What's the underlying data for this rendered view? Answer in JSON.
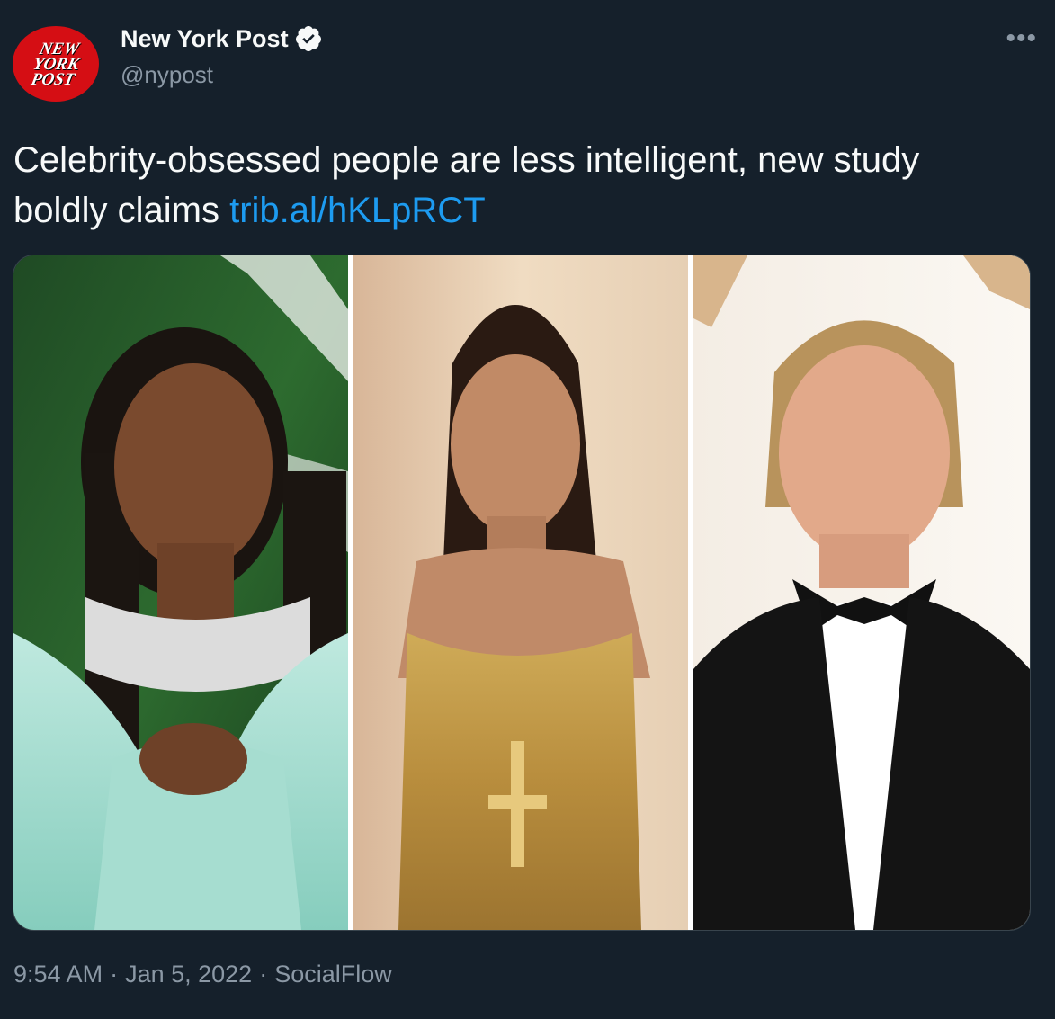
{
  "author": {
    "name": "New York Post",
    "handle": "@nypost",
    "avatar_logo": [
      "NEW",
      "YORK",
      "POST"
    ],
    "verified": true
  },
  "tweet": {
    "text": "Celebrity-obsessed people are less intelligent, new study boldly claims ",
    "link": "trib.al/hKLpRCT"
  },
  "media": {
    "photos": [
      {
        "subject": "woman with braided hair in mint dress and diamond choker"
      },
      {
        "subject": "woman with long dark ponytail in gold sequin dress"
      },
      {
        "subject": "man with slicked back hair in black tuxedo and bow tie"
      }
    ]
  },
  "meta": {
    "time": "9:54 AM",
    "separator": "·",
    "date": "Jan 5, 2022",
    "source": "SocialFlow"
  },
  "icons": {
    "more": "more-options-icon",
    "verified": "verified-badge-icon"
  },
  "colors": {
    "background": "#15202b",
    "text": "#f7f9f9",
    "secondary": "#8b98a5",
    "link": "#1d9bf0",
    "avatar": "#d50e14"
  }
}
